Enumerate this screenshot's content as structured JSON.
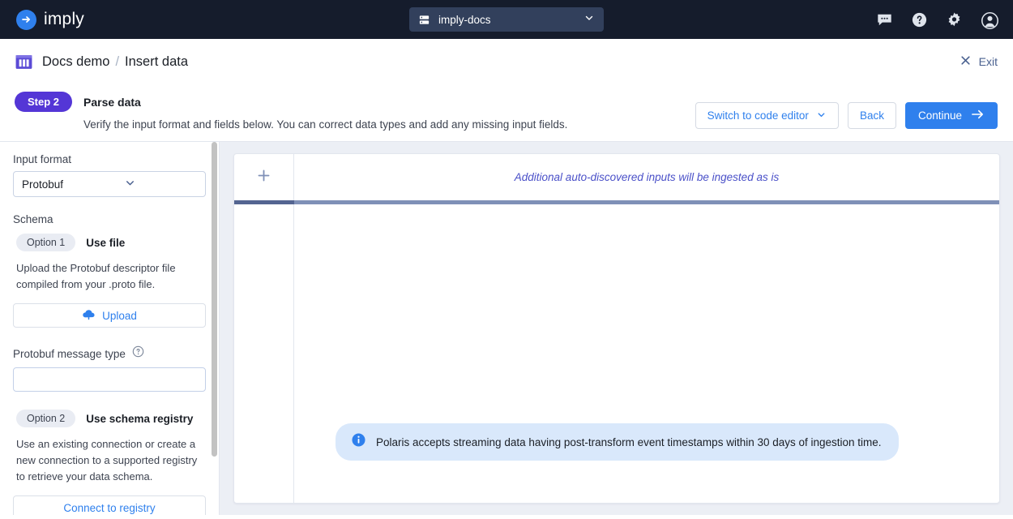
{
  "topnav": {
    "brand_name": "imply",
    "brand_icon": "arrow-circle-logo-icon",
    "org": {
      "icon": "server-stack-icon",
      "name": "imply-docs",
      "chevron": "chevron-down-icon"
    },
    "icons": [
      {
        "name": "feedback-chat-icon"
      },
      {
        "name": "help-circle-icon"
      },
      {
        "name": "gear-icon"
      },
      {
        "name": "user-avatar-icon"
      }
    ]
  },
  "breadcrumb": {
    "icon": "table-columns-icon",
    "project": "Docs demo",
    "separator": "/",
    "current": "Insert data",
    "exit_label": "Exit",
    "exit_icon": "close-x-icon"
  },
  "step_header": {
    "badge": "Step 2",
    "title": "Parse data",
    "subtitle": "Verify the input format and fields below. You can correct data types and add any missing input fields.",
    "actions": {
      "switch_editor": "Switch to code editor",
      "switch_editor_icon": "chevron-down-icon",
      "back": "Back",
      "continue": "Continue",
      "continue_icon": "arrow-right-icon"
    }
  },
  "left_panel": {
    "input_format_label": "Input format",
    "input_format_value": "Protobuf",
    "input_format_chevron": "chevron-down-icon",
    "schema_label": "Schema",
    "option1": {
      "pill": "Option 1",
      "name": "Use file",
      "help": "Upload the Protobuf descriptor file compiled from your .proto file.",
      "button": "Upload",
      "button_icon": "cloud-upload-icon"
    },
    "message_type": {
      "label": "Protobuf message type",
      "help_icon": "question-circle-icon",
      "value": "",
      "placeholder": ""
    },
    "option2": {
      "pill": "Option 2",
      "name": "Use schema registry",
      "help": "Use an existing connection or create a new connection to a supported registry to retrieve your data schema.",
      "button": "Connect to registry"
    }
  },
  "main": {
    "add_column_icon": "plus-icon",
    "table_hint": "Additional auto-discovered inputs will be ingested as is",
    "info_banner": {
      "icon": "info-circle-icon",
      "text": "Polaris accepts streaming data having post-transform event timestamps within 30 days of ingestion time."
    }
  },
  "colors": {
    "nav_bg": "#151c2c",
    "org_bg": "#32405c",
    "brand_blue": "#2f80ed",
    "step_purple": "#5436d6",
    "accent_dark": "#546591",
    "accent_light": "#7f90b7",
    "hint_indigo": "#4a50c8",
    "info_bg": "#d9e8fb",
    "canvas": "#eceff5"
  }
}
